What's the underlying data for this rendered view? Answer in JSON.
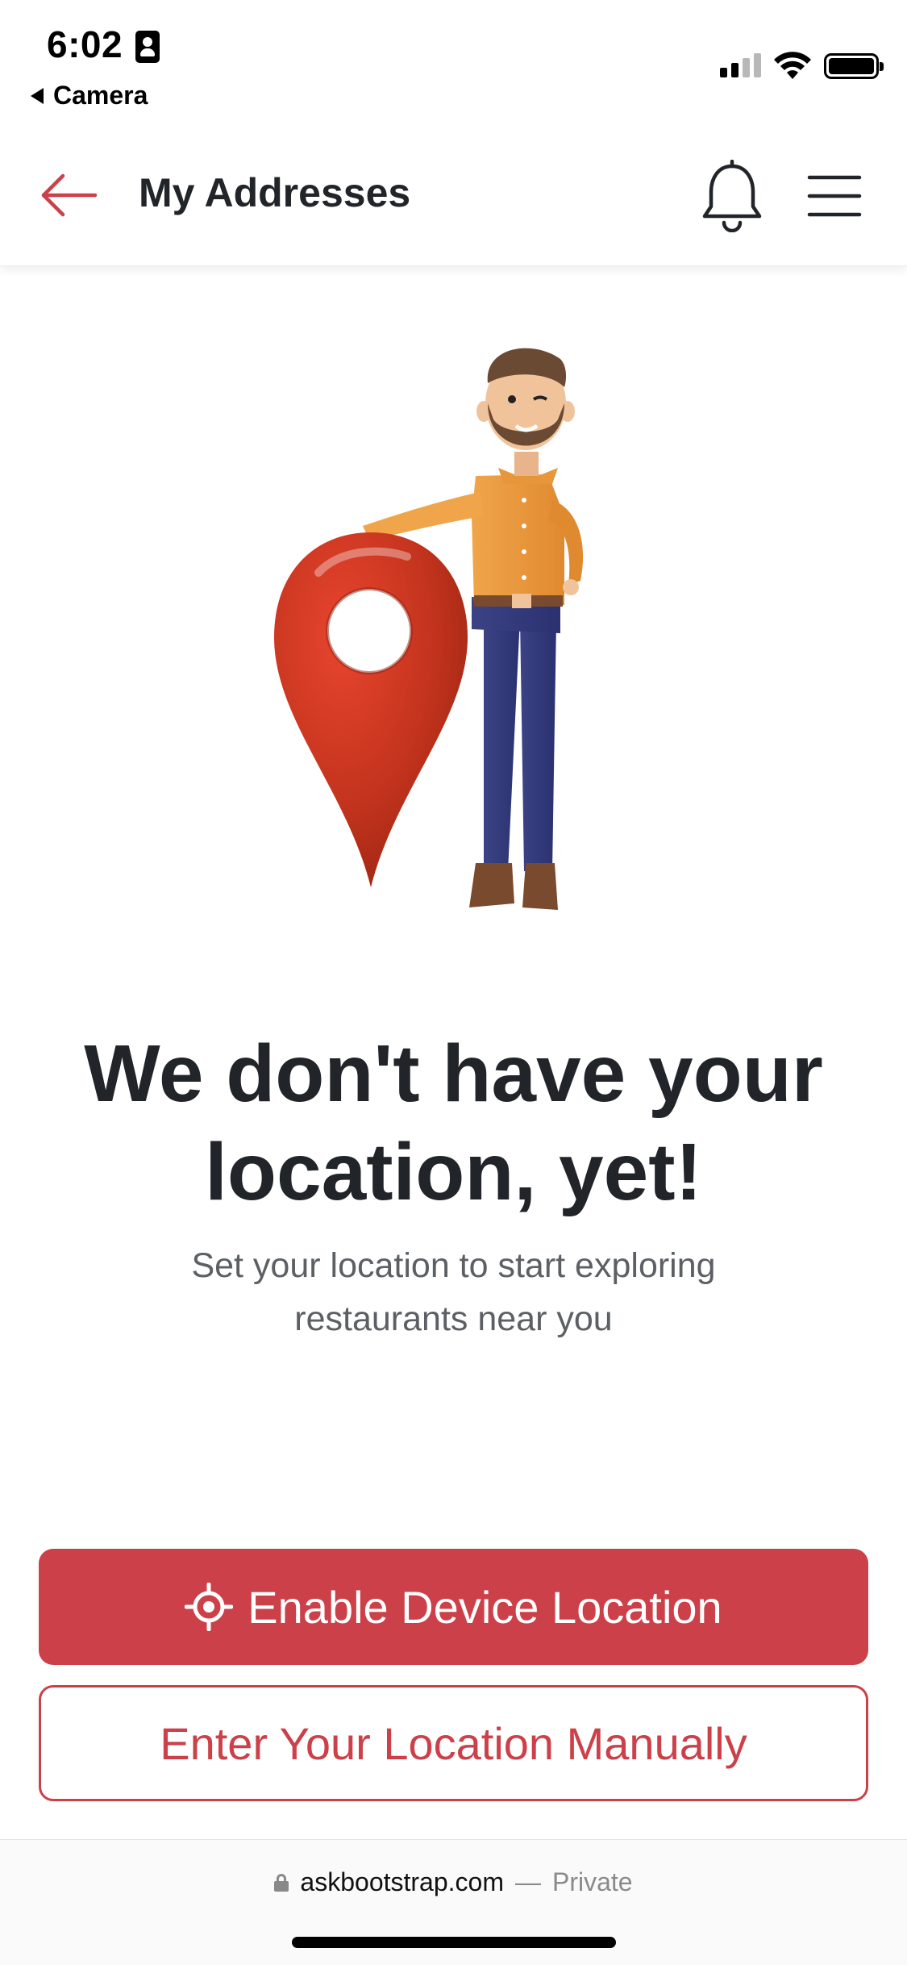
{
  "status_bar": {
    "time": "6:02",
    "back_app": "Camera"
  },
  "header": {
    "title": "My Addresses",
    "back_icon": "arrow-left-icon",
    "notification_icon": "bell-icon",
    "menu_icon": "hamburger-menu-icon"
  },
  "empty_state": {
    "headline_line1": "We don't have your",
    "headline_line2": "location, yet!",
    "subtext_line1": "Set your location to start exploring",
    "subtext_line2": "restaurants near you"
  },
  "actions": {
    "enable_label": "Enable Device Location",
    "enable_icon": "crosshair-icon",
    "manual_label": "Enter Your Location Manually"
  },
  "browser": {
    "url": "askbootstrap.com",
    "separator": "—",
    "mode": "Private"
  },
  "colors": {
    "accent": "#cc4049",
    "text_dark": "#212529",
    "text_muted": "#5c5f63"
  }
}
